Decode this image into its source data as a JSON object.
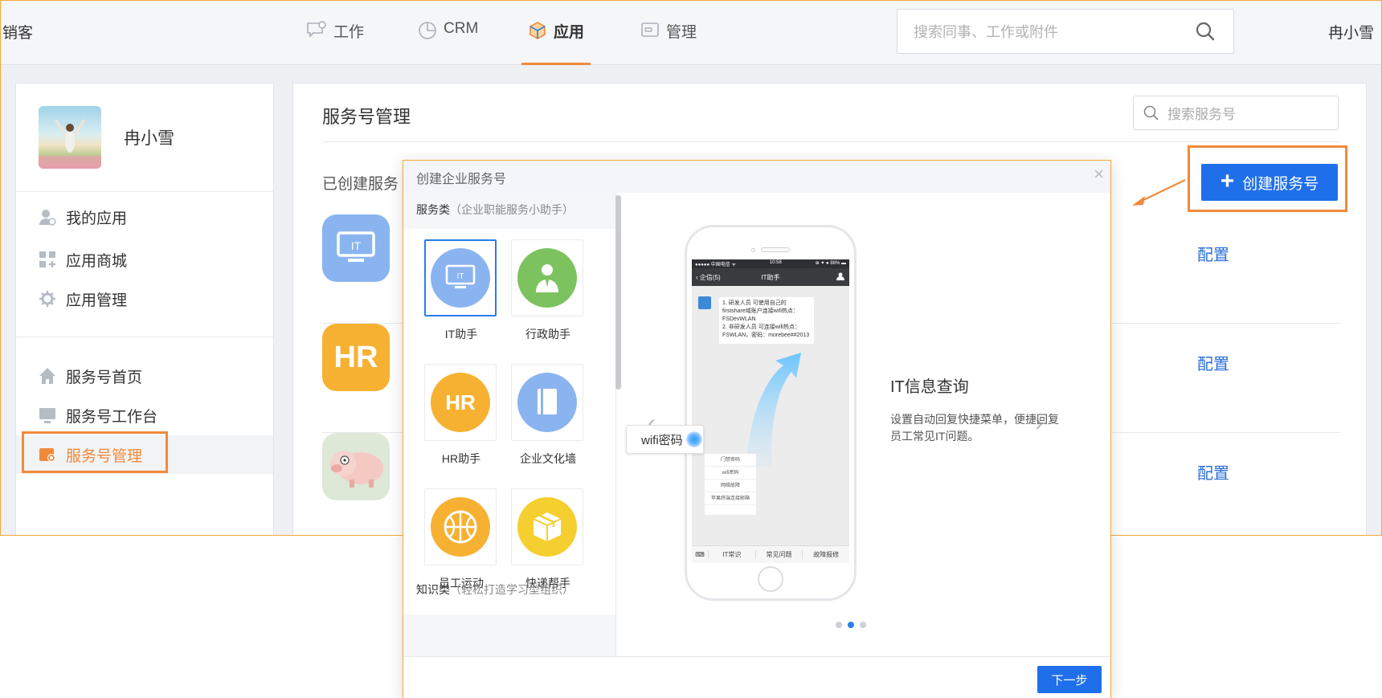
{
  "app": {
    "brand": "销客",
    "nav": [
      {
        "label": "工作",
        "icon": "chat-icon"
      },
      {
        "label": "CRM",
        "icon": "pie-chart-icon"
      },
      {
        "label": "应用",
        "icon": "cube-icon",
        "active": true
      },
      {
        "label": "管理",
        "icon": "card-icon"
      }
    ],
    "search_placeholder": "搜索同事、工作或附件",
    "user": "冉小雪"
  },
  "sidebar": {
    "username": "冉小雪",
    "items": [
      {
        "label": "我的应用",
        "icon": "user-apps-icon"
      },
      {
        "label": "应用商城",
        "icon": "grid-plus-icon"
      },
      {
        "label": "应用管理",
        "icon": "gear-icon"
      },
      {
        "label": "服务号首页",
        "icon": "home-icon"
      },
      {
        "label": "服务号工作台",
        "icon": "monitor-icon"
      },
      {
        "label": "服务号管理",
        "icon": "settings-folder-icon",
        "active": true
      }
    ]
  },
  "main": {
    "title": "服务号管理",
    "search_placeholder": "搜索服务号",
    "created_label": "已创建服务",
    "create_button": "创建服务号",
    "create_button_icon": "plus-icon",
    "rows": [
      {
        "icon": "it-icon",
        "icon_text": "IT",
        "color": "#8ab4f0",
        "action": "配置"
      },
      {
        "icon": "hr-icon",
        "icon_text": "HR",
        "color": "#f7b132",
        "action": "配置"
      },
      {
        "icon": "pig-icon",
        "icon_text": "",
        "color": "#dde8d6",
        "action": "配置"
      }
    ]
  },
  "modal": {
    "title": "创建企业服务号",
    "close_icon": "close-icon",
    "category1": {
      "name": "服务类",
      "desc": "（企业职能服务小助手）"
    },
    "tiles": [
      {
        "label": "IT助手",
        "icon": "it-icon",
        "icon_text": "IT",
        "color": "#8ab4f0",
        "selected": true
      },
      {
        "label": "行政助手",
        "icon": "admin-person-icon",
        "icon_text": "",
        "color": "#7cc35f"
      },
      {
        "label": "HR助手",
        "icon": "hr-icon",
        "icon_text": "HR",
        "color": "#f7b132"
      },
      {
        "label": "企业文化墙",
        "icon": "book-icon",
        "icon_text": "",
        "color": "#8ab4f0"
      },
      {
        "label": "员工运动",
        "icon": "basketball-icon",
        "icon_text": "",
        "color": "#f7b132"
      },
      {
        "label": "快递帮手",
        "icon": "package-icon",
        "icon_text": "",
        "color": "#f5cf2f"
      }
    ],
    "category2": {
      "name": "知识类",
      "desc": "（轻松打造学习型组织）"
    },
    "phone": {
      "status_left": "●●●●● 中国电信 ᯤ",
      "status_time": "10:58",
      "status_right": "⊕ ✦ ● 88% ▬",
      "back_label": "企信(5)",
      "chat_title": "IT助手",
      "message": "1. 研发人员 可使用自己的 firstshare域账户连接wifi热点：FSDevWLAN\n2. 非研发人员 可连接wifi热点：FSWLAN，密码：morebee##2013",
      "quick_menu": [
        "门禁密码",
        "wifi密码",
        "网络故障",
        "苹果终端连接邮箱"
      ],
      "bottom_tabs": [
        "IT常识",
        "常见问题",
        "故障报修"
      ],
      "highlight": "wifi密码"
    },
    "feature_title": "IT信息查询",
    "feature_desc": "设置自动回复快捷菜单，便捷回复员工常见IT问题。",
    "pager": {
      "count": 3,
      "active": 2
    },
    "next_button": "下一步"
  }
}
